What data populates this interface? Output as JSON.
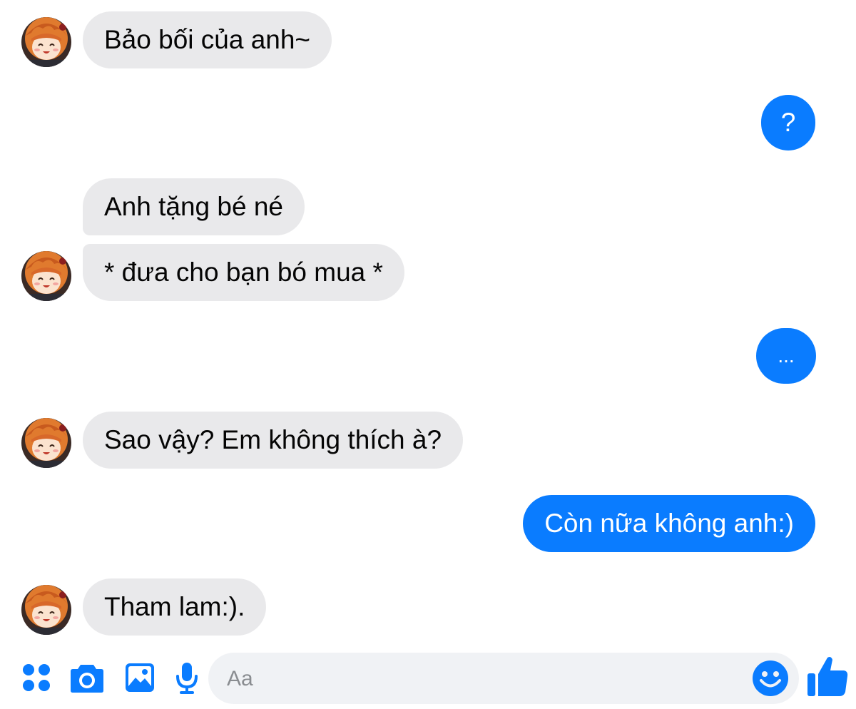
{
  "conversation": {
    "messages": [
      {
        "sender": "contact",
        "text": "Bảo bối của anh~"
      },
      {
        "sender": "me",
        "text": "?"
      },
      {
        "sender": "contact",
        "text": "Anh tặng bé né"
      },
      {
        "sender": "contact",
        "text": "* đưa cho bạn bó mua *"
      },
      {
        "sender": "me",
        "text": "..."
      },
      {
        "sender": "contact",
        "text": "Sao vậy? Em không thích à?"
      },
      {
        "sender": "me",
        "text": "Còn nữa không anh:)"
      },
      {
        "sender": "contact",
        "text": "Tham lam:)."
      }
    ]
  },
  "composer": {
    "placeholder": "Aa",
    "icons": [
      "apps-icon",
      "camera-icon",
      "gallery-icon",
      "microphone-icon",
      "emoji-icon",
      "like-icon"
    ]
  },
  "colors": {
    "accent": "#0a7cff",
    "incoming_bubble": "#e9e9eb",
    "input_background": "#f0f2f5",
    "background": "#ffffff"
  }
}
